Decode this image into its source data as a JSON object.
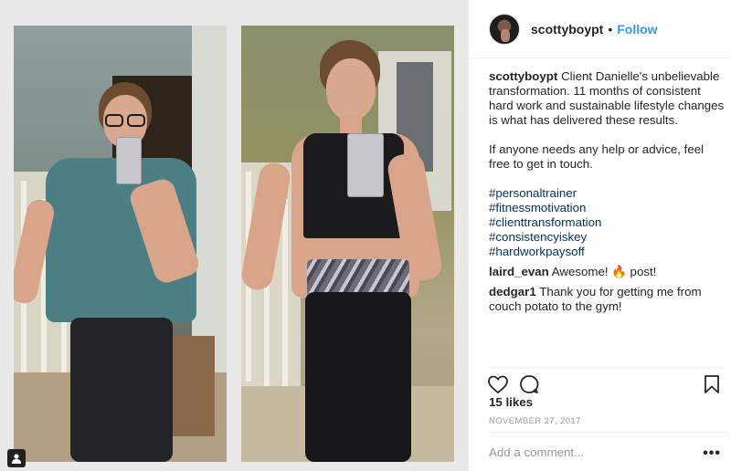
{
  "post": {
    "username": "scottyboypt",
    "separator": "•",
    "follow_label": "Follow",
    "caption": {
      "username": "scottyboypt",
      "line1": "Client Danielle's unbelievable transformation. 11 months of consistent hard work and sustainable lifestyle changes is what has delivered these results.",
      "line2": "If anyone needs any help or advice, feel free to get in touch.",
      "hashtags": [
        "#personaltrainer",
        "#fitnessmotivation",
        "#clienttransformation",
        "#consistencyiskey",
        "#hardworkpaysoff"
      ]
    },
    "comments": [
      {
        "username": "laird_evan",
        "text": "Awesome! 🔥 post!"
      },
      {
        "username": "dedgar1",
        "text": "Thank you for getting me from couch potato to the gym!"
      }
    ],
    "likes_label": "15 likes",
    "date_label": "NOVEMBER 27, 2017",
    "add_comment_placeholder": "Add a comment...",
    "more_label": "•••"
  },
  "icons": {
    "like": "heart-icon",
    "comment": "comment-bubble-icon",
    "save": "bookmark-icon",
    "user_tag": "user-tag-icon"
  },
  "colors": {
    "follow": "#3897f0",
    "hashtag": "#003569",
    "muted": "#999999",
    "text": "#262626"
  }
}
